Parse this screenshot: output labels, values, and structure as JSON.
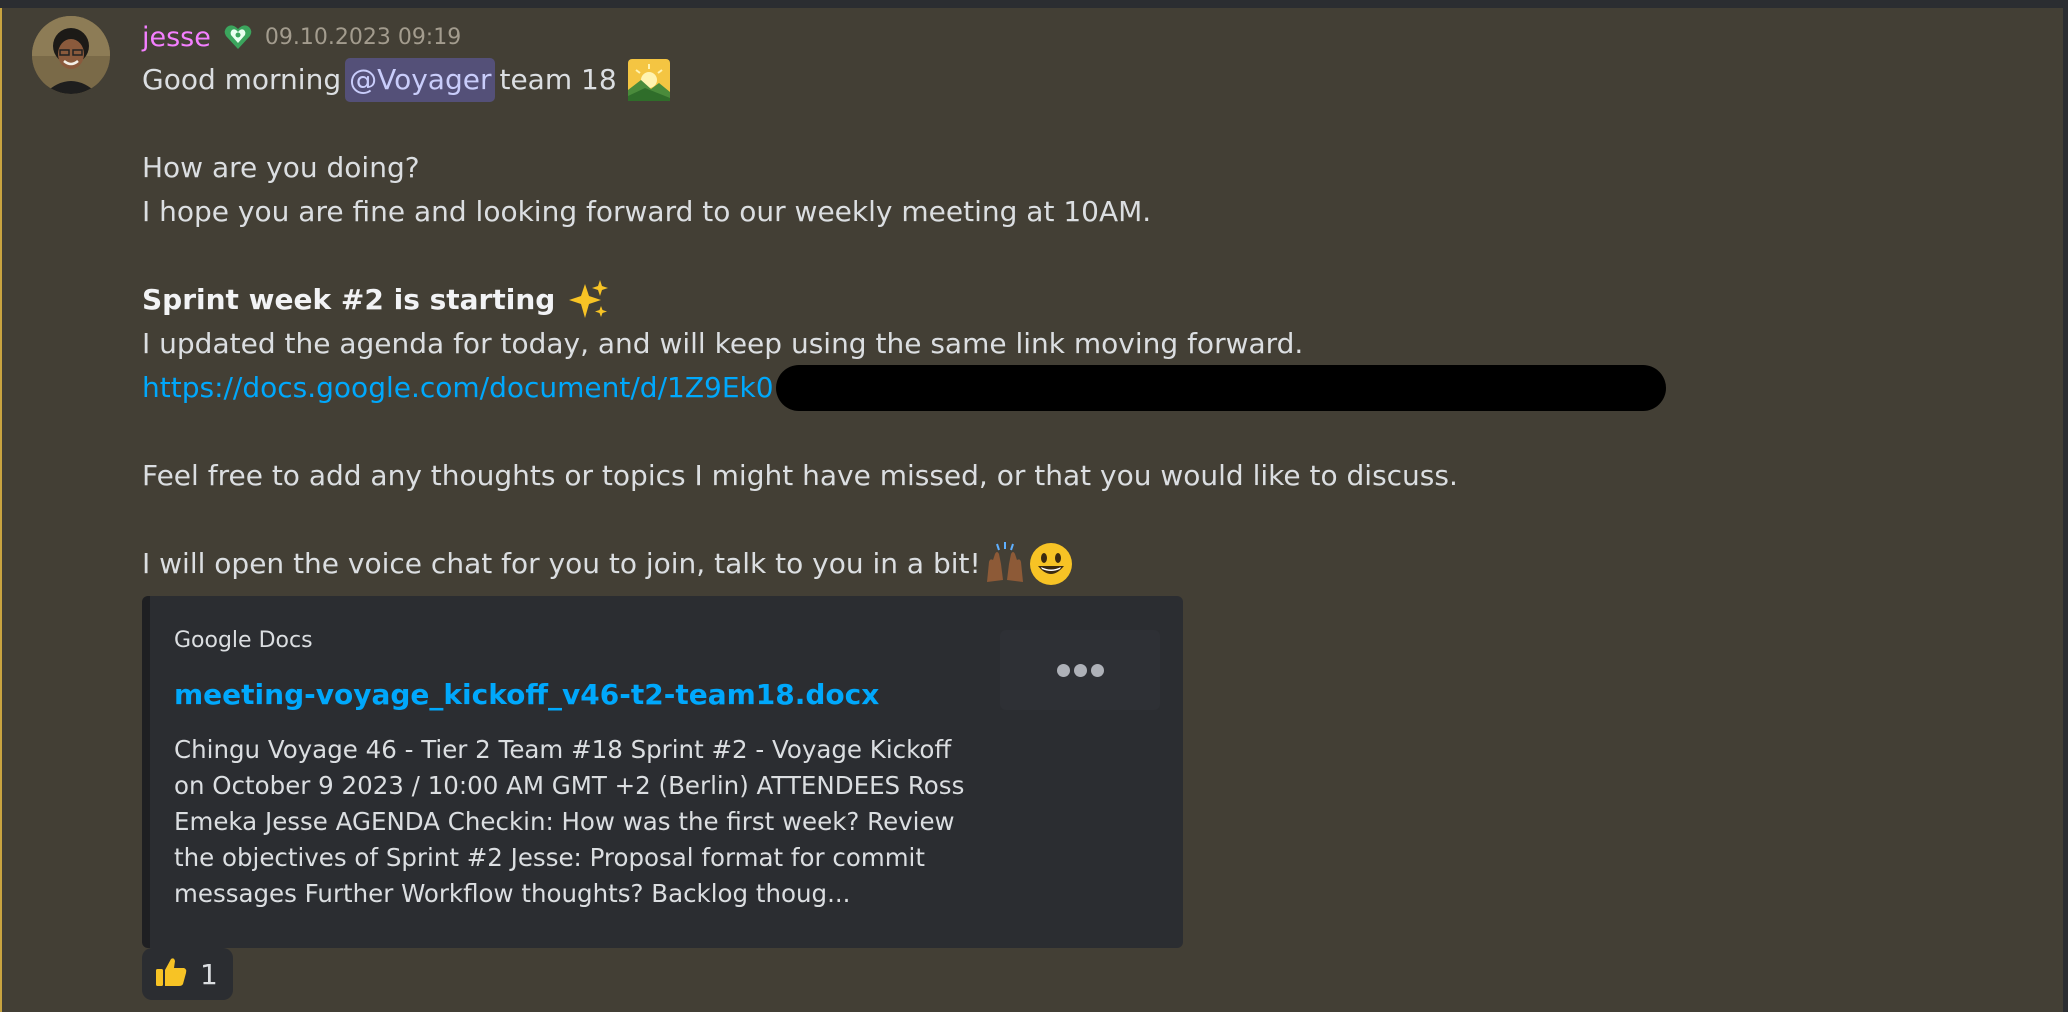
{
  "message": {
    "author": "jesse",
    "timestamp": "09.10.2023 09:19",
    "line1": {
      "prefix": "Good morning",
      "mention": "@Voyager",
      "suffix": "team 18"
    },
    "line3": "How are you doing?",
    "line4": "I hope you are fine and looking forward to our weekly meeting at 10AM.",
    "line6": "Sprint week #2 is starting",
    "line7": "I updated the agenda for today, and will keep using the same link moving forward.",
    "link_visible": "https://docs.google.com/document/d/1Z9Ek0",
    "line10": "Feel free to add any thoughts or topics I might have missed, or that you would like to discuss.",
    "line12": "I will open the voice chat for you to join, talk to you in a bit!"
  },
  "embed": {
    "provider": "Google Docs",
    "title": "meeting-voyage_kickoff_v46-t2-team18.docx",
    "description": "Chingu Voyage 46 - Tier 2 Team #18 Sprint #2 - Voyage Kickoff on October 9 2023 / 10:00 AM GMT +2 (Berlin) ATTENDEES Ross Emeka Jesse AGENDA Checkin: How was the first week? Review the objectives of Sprint #2 Jesse: Proposal format for commit messages Further Workflow thoughts? Backlog thoug..."
  },
  "reaction": {
    "emoji": "thumbs-up-icon",
    "count": "1"
  },
  "icons": {
    "role": "heart-role-icon",
    "sunrise": "sunrise-over-mountains-icon",
    "sparkles": "sparkles-icon",
    "raised_hands": "raised-hands-icon",
    "smiley": "smiley-icon"
  }
}
